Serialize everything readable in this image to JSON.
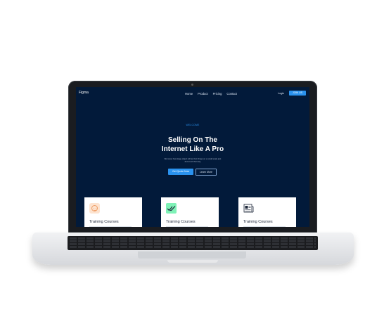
{
  "site": {
    "brand": "Figma",
    "nav": [
      "Home",
      "Product",
      "Pricing",
      "Contact"
    ],
    "login": "Login",
    "join": "JOIN US"
  },
  "hero": {
    "eyebrow": "WELCOME",
    "title_line1": "Selling On The",
    "title_line2": "Internet Like A Pro",
    "subtitle": "We know how large object will act but things on a small scale just donot act that way",
    "primary_button": "Get Quote Now",
    "secondary_button": "Learn More"
  },
  "cards": [
    {
      "title": "Training Courses",
      "icon": "smile-icon"
    },
    {
      "title": "Training Courses",
      "icon": "double-check-icon"
    },
    {
      "title": "Training Courses",
      "icon": "newspaper-icon"
    }
  ],
  "colors": {
    "screen_bg": "#021a3a",
    "accent": "#2a92ee",
    "laptop_frame": "#1a1c20",
    "laptop_base": "#dcdee1"
  }
}
